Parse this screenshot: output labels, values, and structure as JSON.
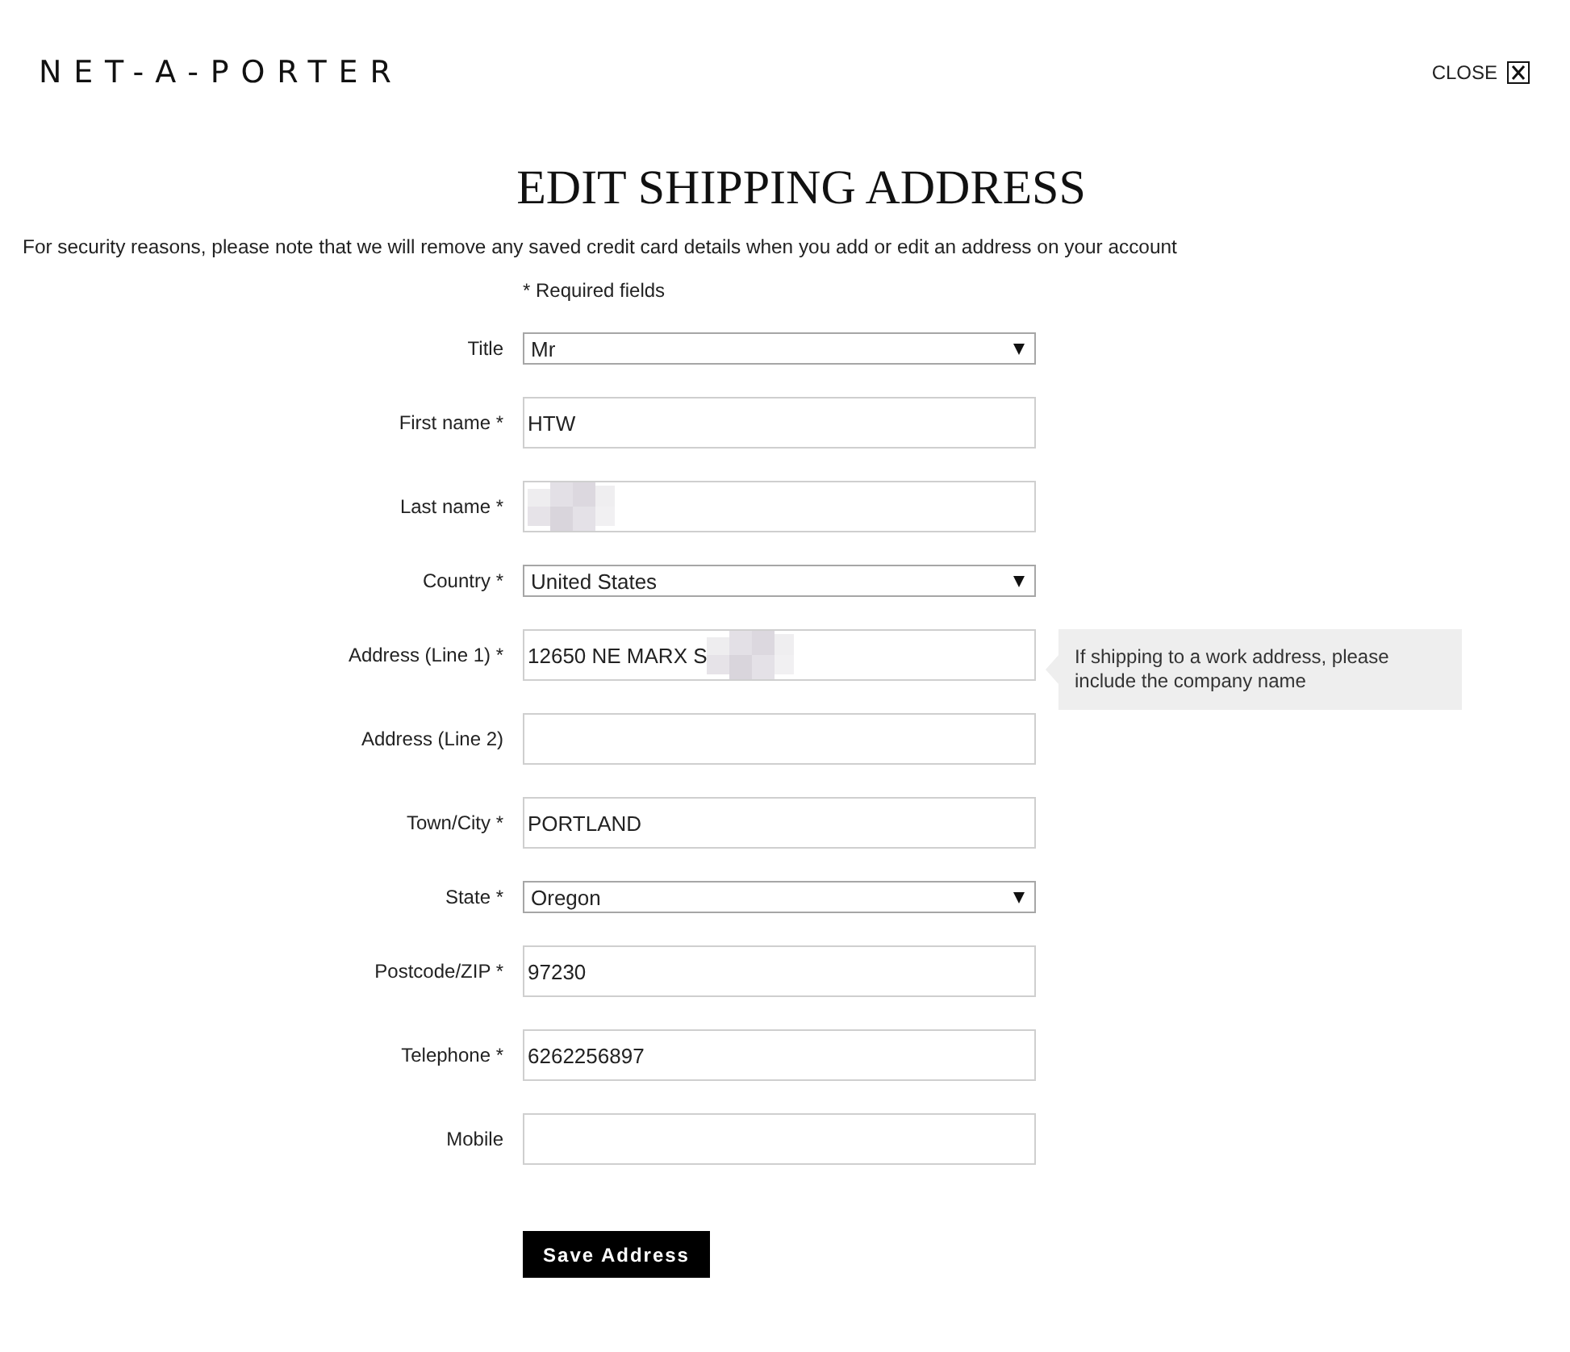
{
  "header": {
    "logo": "NET-A-PORTER",
    "close_label": "CLOSE"
  },
  "title": "EDIT SHIPPING ADDRESS",
  "notice": "For security reasons, please note that we will remove any saved credit card details when you add or edit an address on your account",
  "required_note": "* Required fields",
  "form": {
    "fields": [
      {
        "kind": "select",
        "label": "Title",
        "value": "Mr",
        "redacted": false
      },
      {
        "kind": "text",
        "label": "First name *",
        "value": "HTW",
        "redacted": false
      },
      {
        "kind": "text",
        "label": "Last name *",
        "redacted": true
      },
      {
        "kind": "select",
        "label": "Country *",
        "value": "United States",
        "redacted": false
      },
      {
        "kind": "text",
        "label": "Address (Line 1) *",
        "value": "12650 NE MARX S",
        "redacted": true,
        "hint": "If shipping to a work address, please include the company name"
      },
      {
        "kind": "text",
        "label": "Address (Line 2)",
        "redacted": false
      },
      {
        "kind": "text",
        "label": "Town/City *",
        "value": "PORTLAND",
        "redacted": false
      },
      {
        "kind": "select",
        "label": "State *",
        "value": "Oregon",
        "redacted": false
      },
      {
        "kind": "text",
        "label": "Postcode/ZIP *",
        "value": "97230",
        "redacted": false
      },
      {
        "kind": "text",
        "label": "Telephone *",
        "value": "6262256897",
        "redacted": false
      },
      {
        "kind": "text",
        "label": "Mobile",
        "redacted": false
      }
    ]
  },
  "save_button": "Save Address"
}
